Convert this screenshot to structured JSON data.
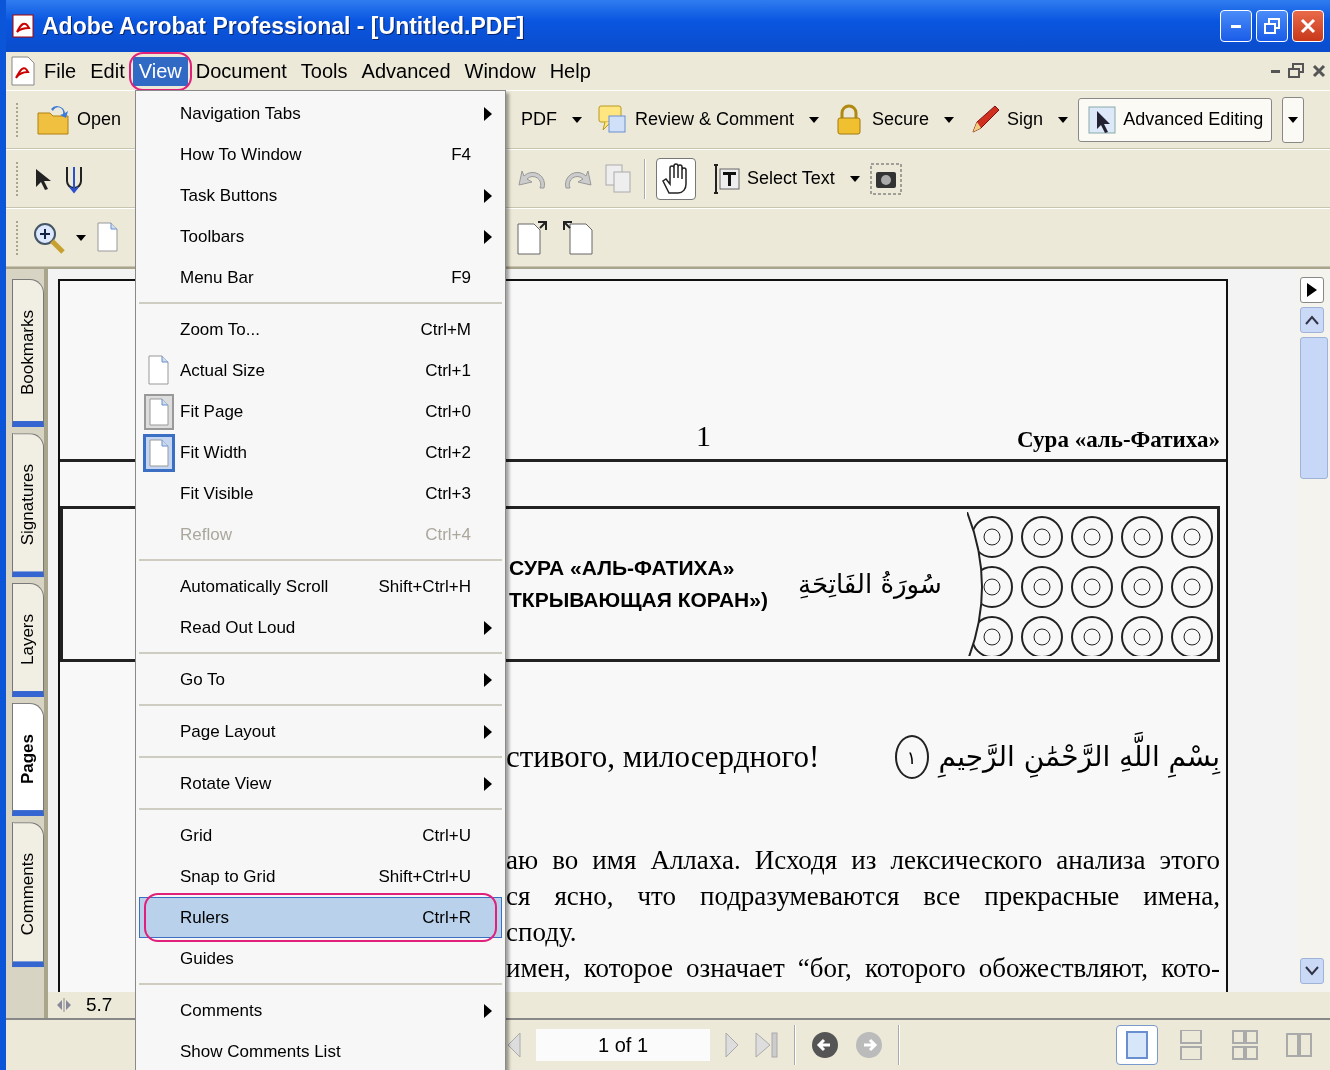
{
  "window": {
    "title": "Adobe Acrobat Professional - [Untitled.PDF]"
  },
  "menu_bar": {
    "items": [
      {
        "label": "File",
        "selected": false,
        "circled": false
      },
      {
        "label": "Edit",
        "selected": false,
        "circled": false
      },
      {
        "label": "View",
        "selected": true,
        "circled": true
      },
      {
        "label": "Document",
        "selected": false,
        "circled": false
      },
      {
        "label": "Tools",
        "selected": false,
        "circled": false
      },
      {
        "label": "Advanced",
        "selected": false,
        "circled": false
      },
      {
        "label": "Window",
        "selected": false,
        "circled": false
      },
      {
        "label": "Help",
        "selected": false,
        "circled": false
      }
    ]
  },
  "toolbars": {
    "open": "Open",
    "tasks": [
      {
        "kind": "create",
        "label": "PDF"
      },
      {
        "kind": "review",
        "label": "Review & Comment"
      },
      {
        "kind": "secure",
        "label": "Secure"
      },
      {
        "kind": "sign",
        "label": "Sign"
      }
    ],
    "advanced_editing": "Advanced Editing",
    "hand_selected": true,
    "select_text": "Select Text"
  },
  "view_menu": {
    "items": [
      {
        "kind": "item",
        "label": "Navigation Tabs",
        "submenu": true,
        "disabled": false,
        "selected": false,
        "circled": false
      },
      {
        "kind": "item",
        "label": "How To Window",
        "shortcut": "F4",
        "submenu": false,
        "disabled": false,
        "selected": false,
        "circled": false
      },
      {
        "kind": "item",
        "label": "Task Buttons",
        "submenu": true,
        "disabled": false,
        "selected": false,
        "circled": false
      },
      {
        "kind": "item",
        "label": "Toolbars",
        "submenu": true,
        "disabled": false,
        "selected": false,
        "circled": false
      },
      {
        "kind": "item",
        "label": "Menu Bar",
        "shortcut": "F9",
        "submenu": false,
        "disabled": false,
        "selected": false,
        "circled": false
      },
      {
        "kind": "separator"
      },
      {
        "kind": "item",
        "label": "Zoom To...",
        "shortcut": "Ctrl+M",
        "submenu": false,
        "disabled": false,
        "selected": false,
        "circled": false
      },
      {
        "kind": "page",
        "label": "Actual Size",
        "shortcut": "Ctrl+1",
        "submenu": false,
        "disabled": false,
        "selected": false,
        "circled": false
      },
      {
        "kind": "framed",
        "label": "Fit Page",
        "shortcut": "Ctrl+0",
        "submenu": false,
        "disabled": false,
        "checked": false,
        "selected": false,
        "circled": false
      },
      {
        "kind": "framed",
        "label": "Fit Width",
        "shortcut": "Ctrl+2",
        "submenu": false,
        "disabled": false,
        "checked": true,
        "selected": false,
        "circled": false
      },
      {
        "kind": "item",
        "label": "Fit Visible",
        "shortcut": "Ctrl+3",
        "submenu": false,
        "disabled": false,
        "selected": false,
        "circled": false
      },
      {
        "kind": "item",
        "label": "Reflow",
        "shortcut": "Ctrl+4",
        "submenu": false,
        "disabled": true,
        "selected": false,
        "circled": false
      },
      {
        "kind": "separator"
      },
      {
        "kind": "item",
        "label": "Automatically Scroll",
        "shortcut": "Shift+Ctrl+H",
        "submenu": false,
        "disabled": false,
        "selected": false,
        "circled": false
      },
      {
        "kind": "item",
        "label": "Read Out Loud",
        "submenu": true,
        "disabled": false,
        "selected": false,
        "circled": false
      },
      {
        "kind": "separator"
      },
      {
        "kind": "item",
        "label": "Go To",
        "submenu": true,
        "disabled": false,
        "selected": false,
        "circled": false
      },
      {
        "kind": "separator"
      },
      {
        "kind": "item",
        "label": "Page Layout",
        "submenu": true,
        "disabled": false,
        "selected": false,
        "circled": false
      },
      {
        "kind": "separator"
      },
      {
        "kind": "item",
        "label": "Rotate View",
        "submenu": true,
        "disabled": false,
        "selected": false,
        "circled": false
      },
      {
        "kind": "separator"
      },
      {
        "kind": "item",
        "label": "Grid",
        "shortcut": "Ctrl+U",
        "submenu": false,
        "disabled": false,
        "selected": false,
        "circled": false
      },
      {
        "kind": "item",
        "label": "Snap to Grid",
        "shortcut": "Shift+Ctrl+U",
        "submenu": false,
        "disabled": false,
        "selected": false,
        "circled": false
      },
      {
        "kind": "item",
        "label": "Rulers",
        "shortcut": "Ctrl+R",
        "submenu": false,
        "disabled": false,
        "selected": true,
        "circled": true
      },
      {
        "kind": "item",
        "label": "Guides",
        "submenu": false,
        "disabled": false,
        "selected": false,
        "circled": false
      },
      {
        "kind": "separator"
      },
      {
        "kind": "item",
        "label": "Comments",
        "submenu": true,
        "disabled": false,
        "selected": false,
        "circled": false
      },
      {
        "kind": "item",
        "label": "Show Comments List",
        "submenu": false,
        "disabled": false,
        "selected": false,
        "circled": false
      }
    ]
  },
  "nav_tabs": [
    {
      "label": "Bookmarks",
      "selected": false
    },
    {
      "label": "Signatures",
      "selected": false
    },
    {
      "label": "Layers",
      "selected": false
    },
    {
      "label": "Pages",
      "selected": true
    },
    {
      "label": "Comments",
      "selected": false
    }
  ],
  "document": {
    "page_number": "1",
    "running_head": "Сура «аль-Фатиха»",
    "banner_lines": [
      "СУРА «АЛЬ-ФАТИХА»",
      "ТКРЫВАЮЩАЯ КОРАН»)"
    ],
    "banner_arabic": "سُورَةُ الفَاتِحَةِ",
    "basmala_translation": "стивого, милосердного!",
    "ayah_number": "١",
    "basmala_arabic": "بِسْمِ اللَّهِ الرَّحْمَٰنِ الرَّحِيمِ",
    "paragraph": [
      "аю во имя Аллаха. Исходя из лексического анализа этого",
      "ся ясно, что подразумеваются все прекрасные имена,",
      "споду.",
      "имен, которое означает “бог, которого обожествляют, кото-"
    ]
  },
  "page_size": "5.7",
  "status_bar": {
    "page_field": "1 of 1",
    "layouts": [
      {
        "kind": "single",
        "selected": true
      },
      {
        "kind": "continuous",
        "selected": false
      },
      {
        "kind": "continuous-facing",
        "selected": false
      },
      {
        "kind": "facing",
        "selected": false
      }
    ]
  }
}
